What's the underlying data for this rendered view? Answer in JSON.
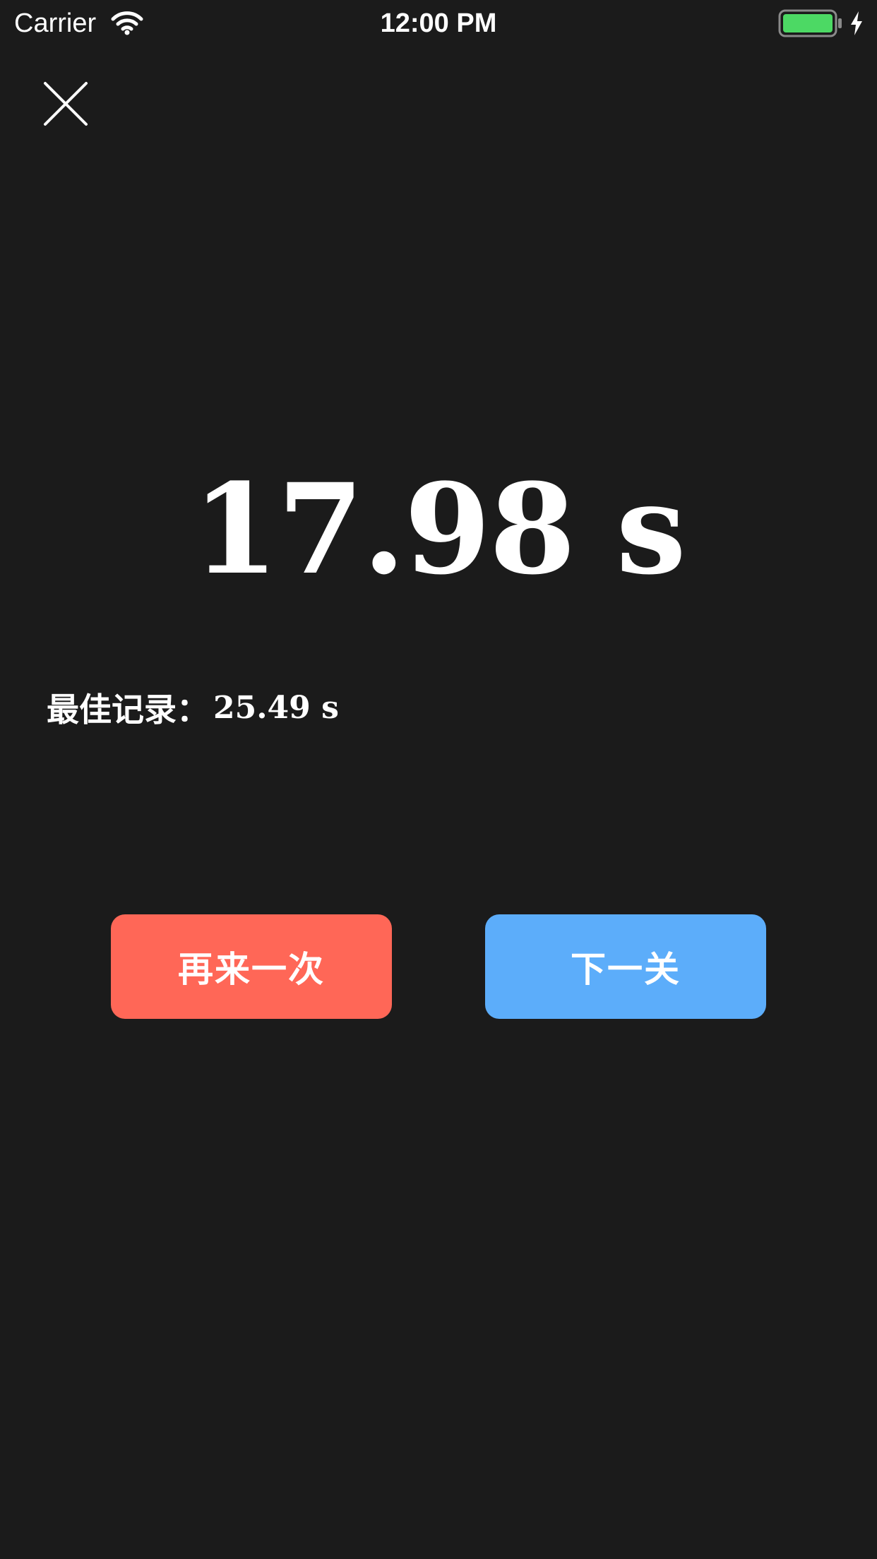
{
  "status_bar": {
    "carrier": "Carrier",
    "time": "12:00 PM",
    "icons": [
      "wifi-icon",
      "battery-icon",
      "charging-icon"
    ],
    "battery_color": "#4cd964"
  },
  "header": {
    "close_icon": "close-icon"
  },
  "result": {
    "time": "17.98 s",
    "best_label": "最佳记录：",
    "best_value": "25.49 s"
  },
  "buttons": {
    "retry_label": "再来一次",
    "retry_color": "#ff6757",
    "next_label": "下一关",
    "next_color": "#5cadfa"
  },
  "colors": {
    "background": "#1b1b1b",
    "text": "#ffffff"
  }
}
